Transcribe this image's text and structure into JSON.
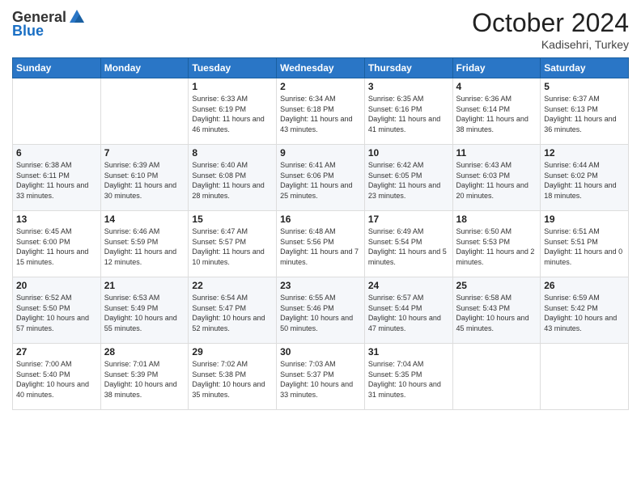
{
  "logo": {
    "general": "General",
    "blue": "Blue"
  },
  "header": {
    "month": "October 2024",
    "location": "Kadisehri, Turkey"
  },
  "weekdays": [
    "Sunday",
    "Monday",
    "Tuesday",
    "Wednesday",
    "Thursday",
    "Friday",
    "Saturday"
  ],
  "weeks": [
    [
      {
        "day": "",
        "sunrise": "",
        "sunset": "",
        "daylight": ""
      },
      {
        "day": "",
        "sunrise": "",
        "sunset": "",
        "daylight": ""
      },
      {
        "day": "1",
        "sunrise": "Sunrise: 6:33 AM",
        "sunset": "Sunset: 6:19 PM",
        "daylight": "Daylight: 11 hours and 46 minutes."
      },
      {
        "day": "2",
        "sunrise": "Sunrise: 6:34 AM",
        "sunset": "Sunset: 6:18 PM",
        "daylight": "Daylight: 11 hours and 43 minutes."
      },
      {
        "day": "3",
        "sunrise": "Sunrise: 6:35 AM",
        "sunset": "Sunset: 6:16 PM",
        "daylight": "Daylight: 11 hours and 41 minutes."
      },
      {
        "day": "4",
        "sunrise": "Sunrise: 6:36 AM",
        "sunset": "Sunset: 6:14 PM",
        "daylight": "Daylight: 11 hours and 38 minutes."
      },
      {
        "day": "5",
        "sunrise": "Sunrise: 6:37 AM",
        "sunset": "Sunset: 6:13 PM",
        "daylight": "Daylight: 11 hours and 36 minutes."
      }
    ],
    [
      {
        "day": "6",
        "sunrise": "Sunrise: 6:38 AM",
        "sunset": "Sunset: 6:11 PM",
        "daylight": "Daylight: 11 hours and 33 minutes."
      },
      {
        "day": "7",
        "sunrise": "Sunrise: 6:39 AM",
        "sunset": "Sunset: 6:10 PM",
        "daylight": "Daylight: 11 hours and 30 minutes."
      },
      {
        "day": "8",
        "sunrise": "Sunrise: 6:40 AM",
        "sunset": "Sunset: 6:08 PM",
        "daylight": "Daylight: 11 hours and 28 minutes."
      },
      {
        "day": "9",
        "sunrise": "Sunrise: 6:41 AM",
        "sunset": "Sunset: 6:06 PM",
        "daylight": "Daylight: 11 hours and 25 minutes."
      },
      {
        "day": "10",
        "sunrise": "Sunrise: 6:42 AM",
        "sunset": "Sunset: 6:05 PM",
        "daylight": "Daylight: 11 hours and 23 minutes."
      },
      {
        "day": "11",
        "sunrise": "Sunrise: 6:43 AM",
        "sunset": "Sunset: 6:03 PM",
        "daylight": "Daylight: 11 hours and 20 minutes."
      },
      {
        "day": "12",
        "sunrise": "Sunrise: 6:44 AM",
        "sunset": "Sunset: 6:02 PM",
        "daylight": "Daylight: 11 hours and 18 minutes."
      }
    ],
    [
      {
        "day": "13",
        "sunrise": "Sunrise: 6:45 AM",
        "sunset": "Sunset: 6:00 PM",
        "daylight": "Daylight: 11 hours and 15 minutes."
      },
      {
        "day": "14",
        "sunrise": "Sunrise: 6:46 AM",
        "sunset": "Sunset: 5:59 PM",
        "daylight": "Daylight: 11 hours and 12 minutes."
      },
      {
        "day": "15",
        "sunrise": "Sunrise: 6:47 AM",
        "sunset": "Sunset: 5:57 PM",
        "daylight": "Daylight: 11 hours and 10 minutes."
      },
      {
        "day": "16",
        "sunrise": "Sunrise: 6:48 AM",
        "sunset": "Sunset: 5:56 PM",
        "daylight": "Daylight: 11 hours and 7 minutes."
      },
      {
        "day": "17",
        "sunrise": "Sunrise: 6:49 AM",
        "sunset": "Sunset: 5:54 PM",
        "daylight": "Daylight: 11 hours and 5 minutes."
      },
      {
        "day": "18",
        "sunrise": "Sunrise: 6:50 AM",
        "sunset": "Sunset: 5:53 PM",
        "daylight": "Daylight: 11 hours and 2 minutes."
      },
      {
        "day": "19",
        "sunrise": "Sunrise: 6:51 AM",
        "sunset": "Sunset: 5:51 PM",
        "daylight": "Daylight: 11 hours and 0 minutes."
      }
    ],
    [
      {
        "day": "20",
        "sunrise": "Sunrise: 6:52 AM",
        "sunset": "Sunset: 5:50 PM",
        "daylight": "Daylight: 10 hours and 57 minutes."
      },
      {
        "day": "21",
        "sunrise": "Sunrise: 6:53 AM",
        "sunset": "Sunset: 5:49 PM",
        "daylight": "Daylight: 10 hours and 55 minutes."
      },
      {
        "day": "22",
        "sunrise": "Sunrise: 6:54 AM",
        "sunset": "Sunset: 5:47 PM",
        "daylight": "Daylight: 10 hours and 52 minutes."
      },
      {
        "day": "23",
        "sunrise": "Sunrise: 6:55 AM",
        "sunset": "Sunset: 5:46 PM",
        "daylight": "Daylight: 10 hours and 50 minutes."
      },
      {
        "day": "24",
        "sunrise": "Sunrise: 6:57 AM",
        "sunset": "Sunset: 5:44 PM",
        "daylight": "Daylight: 10 hours and 47 minutes."
      },
      {
        "day": "25",
        "sunrise": "Sunrise: 6:58 AM",
        "sunset": "Sunset: 5:43 PM",
        "daylight": "Daylight: 10 hours and 45 minutes."
      },
      {
        "day": "26",
        "sunrise": "Sunrise: 6:59 AM",
        "sunset": "Sunset: 5:42 PM",
        "daylight": "Daylight: 10 hours and 43 minutes."
      }
    ],
    [
      {
        "day": "27",
        "sunrise": "Sunrise: 7:00 AM",
        "sunset": "Sunset: 5:40 PM",
        "daylight": "Daylight: 10 hours and 40 minutes."
      },
      {
        "day": "28",
        "sunrise": "Sunrise: 7:01 AM",
        "sunset": "Sunset: 5:39 PM",
        "daylight": "Daylight: 10 hours and 38 minutes."
      },
      {
        "day": "29",
        "sunrise": "Sunrise: 7:02 AM",
        "sunset": "Sunset: 5:38 PM",
        "daylight": "Daylight: 10 hours and 35 minutes."
      },
      {
        "day": "30",
        "sunrise": "Sunrise: 7:03 AM",
        "sunset": "Sunset: 5:37 PM",
        "daylight": "Daylight: 10 hours and 33 minutes."
      },
      {
        "day": "31",
        "sunrise": "Sunrise: 7:04 AM",
        "sunset": "Sunset: 5:35 PM",
        "daylight": "Daylight: 10 hours and 31 minutes."
      },
      {
        "day": "",
        "sunrise": "",
        "sunset": "",
        "daylight": ""
      },
      {
        "day": "",
        "sunrise": "",
        "sunset": "",
        "daylight": ""
      }
    ]
  ]
}
